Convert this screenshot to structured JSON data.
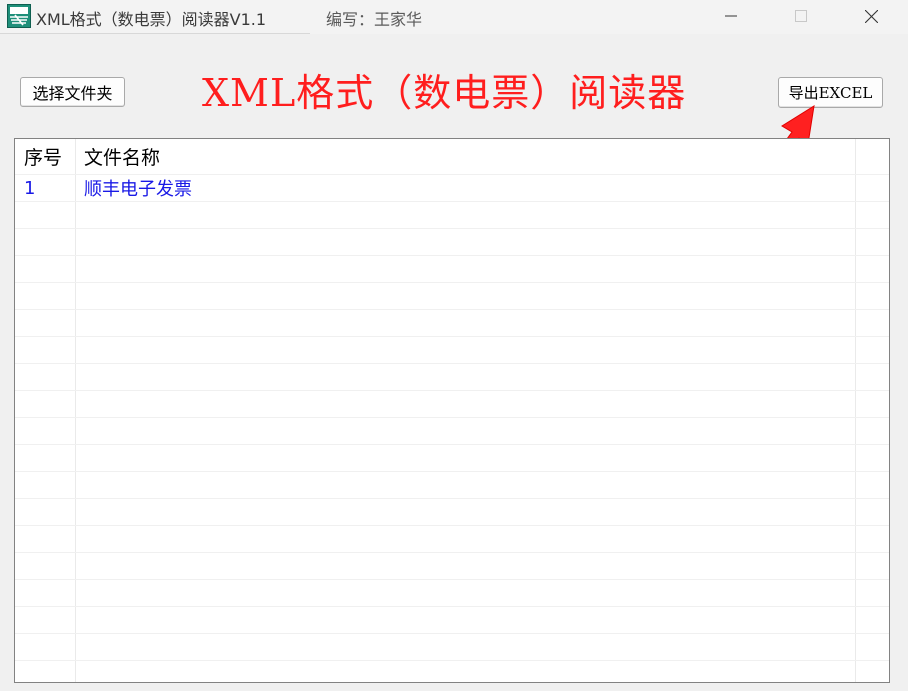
{
  "window": {
    "title": "XML格式（数电票）阅读器V1.1",
    "author": "编写：王家华"
  },
  "toolbar": {
    "select_folder_label": "选择文件夹",
    "export_label": "导出EXCEL",
    "heading": "XML格式（数电票）阅读器"
  },
  "table": {
    "columns": [
      "序号",
      "文件名称"
    ],
    "rows": [
      {
        "seq": "1",
        "name": "顺丰电子发票"
      }
    ]
  },
  "colors": {
    "heading": "#ff1e1e",
    "row_text": "#1919e6",
    "arrow": "#ff2020"
  },
  "icons": {
    "app": "app-logo-icon",
    "minimize": "minimize-icon",
    "maximize": "maximize-icon",
    "close": "close-icon",
    "annotation": "red-arrow-icon"
  }
}
